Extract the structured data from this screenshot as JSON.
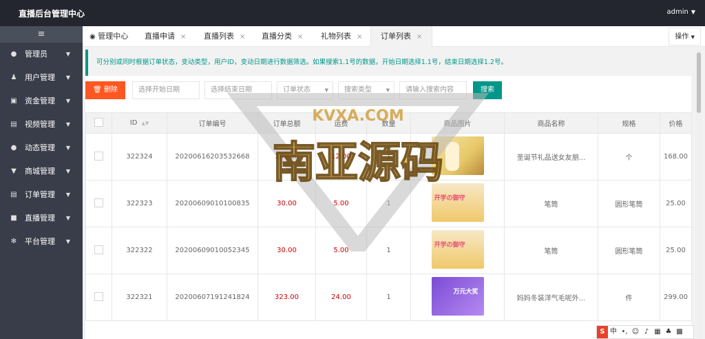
{
  "app": {
    "title": "直播后台管理中心",
    "user": "admin"
  },
  "sidebar": {
    "toggle": "≡",
    "items": [
      {
        "label": "管理员",
        "icon": "user-icon",
        "glyph": "●"
      },
      {
        "label": "用户管理",
        "icon": "users-icon",
        "glyph": "♟"
      },
      {
        "label": "资金管理",
        "icon": "money-icon",
        "glyph": "▣"
      },
      {
        "label": "视频管理",
        "icon": "film-icon",
        "glyph": "▤"
      },
      {
        "label": "动态管理",
        "icon": "comments-icon",
        "glyph": "●"
      },
      {
        "label": "商城管理",
        "icon": "cart-icon",
        "glyph": "▼"
      },
      {
        "label": "订单管理",
        "icon": "list-icon",
        "glyph": "▤"
      },
      {
        "label": "直播管理",
        "icon": "camera-icon",
        "glyph": "■"
      },
      {
        "label": "平台管理",
        "icon": "gears-icon",
        "glyph": "✻"
      }
    ]
  },
  "tabs": {
    "home": "管理中心",
    "items": [
      "直播申请",
      "直播列表",
      "直播分类",
      "礼物列表",
      "订单列表"
    ],
    "close": "×",
    "ops": "操作"
  },
  "notice": "可分别或同时根据订单状态，变动类型，用户ID，变动日期进行数据筛选。如果搜索1.1号的数据，开始日期选择1.1号，结束日期选择1.2号。",
  "toolbar": {
    "delete": "删除",
    "start_date": "选择开始日期",
    "end_date": "选择结束日期",
    "order_status": "订单状态",
    "search_type": "搜索类型",
    "keyword": "请输入搜索内容",
    "search": "搜索"
  },
  "table": {
    "headers": [
      "",
      "ID",
      "订单编号",
      "订单总额",
      "运费",
      "数量",
      "商品图片",
      "商品名称",
      "规格",
      "价格"
    ],
    "rows": [
      {
        "id": "322324",
        "order_no": "20200616203532668",
        "total": "180.00",
        "freight": "12.00",
        "qty": "1",
        "image_text": "",
        "name": "圣诞节礼品送女友朋...",
        "spec": "个",
        "price": "168.00"
      },
      {
        "id": "322323",
        "order_no": "20200609010100835",
        "total": "30.00",
        "freight": "5.00",
        "qty": "1",
        "image_text": "开学の御守",
        "name": "笔筒",
        "spec": "圆形笔筒",
        "price": "25.00"
      },
      {
        "id": "322322",
        "order_no": "20200609010052345",
        "total": "30.00",
        "freight": "5.00",
        "qty": "1",
        "image_text": "开学の御守",
        "name": "笔筒",
        "spec": "圆形笔筒",
        "price": "25.00"
      },
      {
        "id": "322321",
        "order_no": "20200607191241824",
        "total": "323.00",
        "freight": "24.00",
        "qty": "1",
        "image_text": "万元大奖",
        "name": "妈妈冬装洋气毛呢外...",
        "spec": "件",
        "price": "299.00"
      }
    ]
  },
  "watermark": {
    "top": "KVXA.COM",
    "main": "南亚源码"
  },
  "ime": {
    "logo": "S",
    "lang": "中"
  },
  "colors": {
    "accent": "#009688",
    "danger": "#ff5722",
    "topbar": "#23262e",
    "sidebar": "#393d49"
  }
}
